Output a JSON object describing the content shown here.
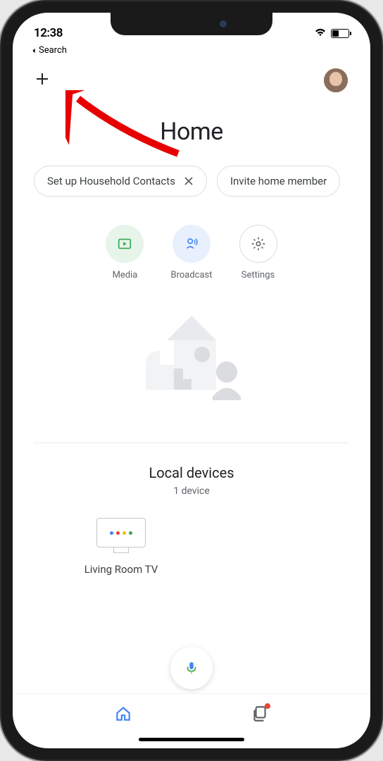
{
  "status": {
    "time": "12:38"
  },
  "backNav": {
    "label": "Search"
  },
  "page": {
    "title": "Home"
  },
  "chips": [
    {
      "label": "Set up Household Contacts"
    },
    {
      "label": "Invite home member"
    }
  ],
  "quickActions": {
    "media": "Media",
    "broadcast": "Broadcast",
    "settings": "Settings"
  },
  "localDevices": {
    "title": "Local devices",
    "subtitle": "1 device"
  },
  "devices": [
    {
      "name": "Living Room TV"
    }
  ],
  "colors": {
    "googleBlue": "#4285f4",
    "googleRed": "#ea4335",
    "googleYellow": "#fbbc05",
    "googleGreen": "#34a853",
    "arrowRed": "#e60000"
  }
}
